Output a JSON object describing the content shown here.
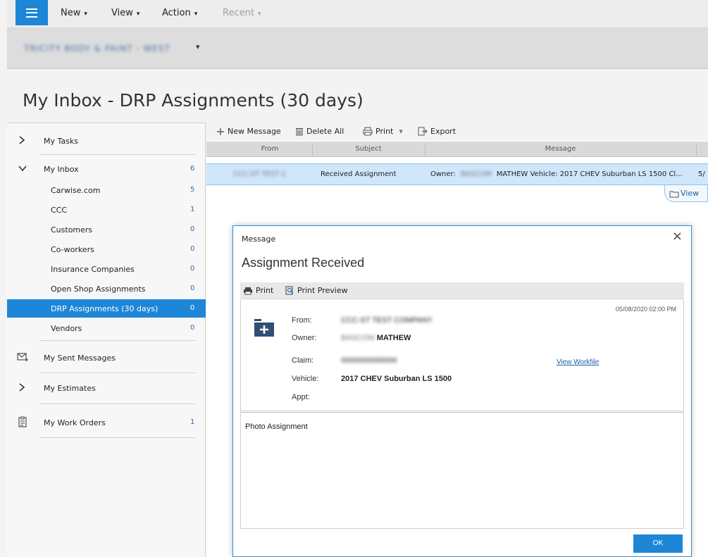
{
  "menu": {
    "items": [
      {
        "label": "New",
        "caret": "▾"
      },
      {
        "label": "View",
        "caret": "▾"
      },
      {
        "label": "Action",
        "caret": "▾"
      },
      {
        "label": "Recent",
        "caret": "▾"
      }
    ]
  },
  "shop": {
    "name": "TRICITY BODY & PAINT - WEST",
    "caret": "▾"
  },
  "page_title": "My Inbox - DRP Assignments (30 days)",
  "sidebar": {
    "items": [
      {
        "label": "My Tasks",
        "icon": "chevron-right-icon",
        "count": ""
      },
      {
        "label": "My Inbox",
        "icon": "chevron-down-icon",
        "count": "6"
      },
      {
        "label": "Carwise.com",
        "count": "5"
      },
      {
        "label": "CCC",
        "count": "1"
      },
      {
        "label": "Customers",
        "count": "0"
      },
      {
        "label": "Co-workers",
        "count": "0"
      },
      {
        "label": "Insurance Companies",
        "count": "0"
      },
      {
        "label": "Open Shop Assignments",
        "count": "0"
      },
      {
        "label": "DRP Assignments (30 days)",
        "count": "0"
      },
      {
        "label": "Vendors",
        "count": "0"
      },
      {
        "label": "My Sent Messages",
        "icon": "envelope-sent-icon",
        "count": ""
      },
      {
        "label": "My Estimates",
        "icon": "chevron-right-icon",
        "count": ""
      },
      {
        "label": "My Work Orders",
        "icon": "clipboard-icon",
        "count": "1"
      }
    ]
  },
  "toolbar": {
    "new_message": "New Message",
    "delete_all": "Delete All",
    "print": "Print",
    "print_caret": "▾",
    "export": "Export"
  },
  "grid": {
    "headers": [
      "From",
      "Subject",
      "Message"
    ],
    "row": {
      "from": "CCC-ST TEST C",
      "subject": "Received Assignment",
      "message_prefix": "Owner:",
      "message_blur": "BASCOM",
      "message_rest": "MATHEW Vehicle: 2017 CHEV Suburban LS 1500 Cl...",
      "extra": "5/"
    },
    "view_button": "View"
  },
  "dialog": {
    "title": "Message",
    "close": "×",
    "heading": "Assignment Received",
    "toolbar": {
      "print": "Print",
      "print_preview": "Print Preview"
    },
    "date": "05/08/2020 02:00 PM",
    "fields": {
      "from_label": "From:",
      "from_value": "CCC-ST TEST COMPANY",
      "owner_label": "Owner:",
      "owner_blur": "BASCOM",
      "owner_value": "MATHEW",
      "claim_label": "Claim:",
      "claim_value": "0000000000000",
      "vehicle_label": "Vehicle:",
      "vehicle_value": "2017 CHEV Suburban LS 1500",
      "appt_label": "Appt:"
    },
    "view_workfile": "View Workfile",
    "body": "Photo Assignment",
    "ok": "OK"
  },
  "colors": {
    "accent": "#1e86d7",
    "selected_row": "#cfe6fb",
    "link": "#1b5fa8"
  }
}
